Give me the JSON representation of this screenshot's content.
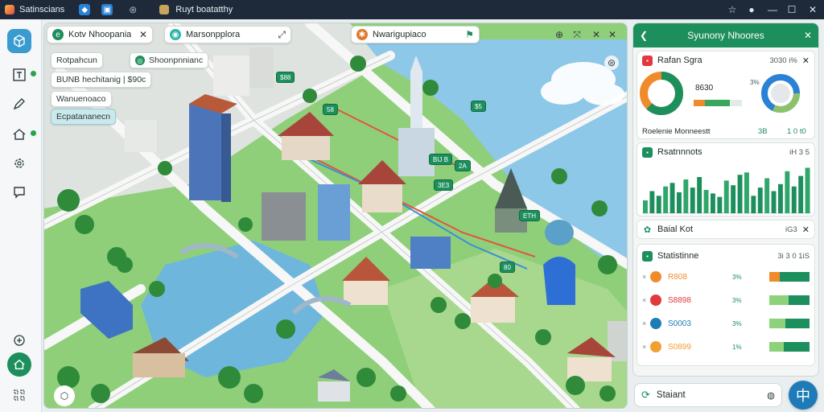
{
  "titlebar": {
    "app_name": "Satinscians",
    "tab_title": "Ruyt boatatthy"
  },
  "map": {
    "tabs": [
      {
        "label": "Kotv Nhoopania"
      },
      {
        "label": "Marsonpplora"
      },
      {
        "label": "Nwarigupiaco"
      }
    ],
    "chips": [
      {
        "label": "Rotpahcun"
      },
      {
        "label": "Shoonpnnianc"
      },
      {
        "label": "BUNB   hechitanig | $90c"
      },
      {
        "label": "Wanuenoaco"
      },
      {
        "label": "Ecpatananecn"
      }
    ],
    "labels": [
      "$88",
      "58",
      "$5",
      "BIJ B",
      "2A",
      "3E3",
      "ETH",
      "80"
    ]
  },
  "panel": {
    "title": "Syunony Nhoores",
    "card1": {
      "title": "Rafan Sgra",
      "meta": "3030 i%",
      "value": "8630",
      "pct": "3%",
      "footer": "Roelenie Monneestt",
      "footer_a": "3B",
      "footer_b": "1 0 t0",
      "donut": [
        0.62,
        0.38
      ],
      "progress": 0.75
    },
    "card2": {
      "title": "Rsatnnnots",
      "meta": "iH 3 5",
      "chart_data": {
        "type": "bar",
        "values": [
          22,
          38,
          30,
          46,
          52,
          36,
          58,
          44,
          62,
          40,
          34,
          28,
          56,
          48,
          66,
          70,
          30,
          44,
          60,
          38,
          50,
          72,
          46,
          64,
          78
        ]
      }
    },
    "card3": {
      "title": "Baial Kot",
      "meta": "iG3"
    },
    "card4": {
      "title": "Statistinne",
      "meta": "3i 3 0 1iS",
      "rows": [
        {
          "label": "R808",
          "pct": "3%",
          "icon_color": "#f08b2c",
          "fill": 0.25
        },
        {
          "label": "S8898",
          "pct": "3%",
          "icon_color": "#e0393e",
          "fill": 0.48
        },
        {
          "label": "S0003",
          "pct": "3%",
          "icon_color": "#1e7bb8",
          "fill": 0.4
        },
        {
          "label": "S0899",
          "pct": "1%",
          "icon_color": "#f0a030",
          "fill": 0.35
        }
      ]
    },
    "bottom": {
      "label": "Staiant"
    }
  },
  "colors": {
    "brand": "#1d8f5c",
    "accent": "#1e7bb8"
  }
}
